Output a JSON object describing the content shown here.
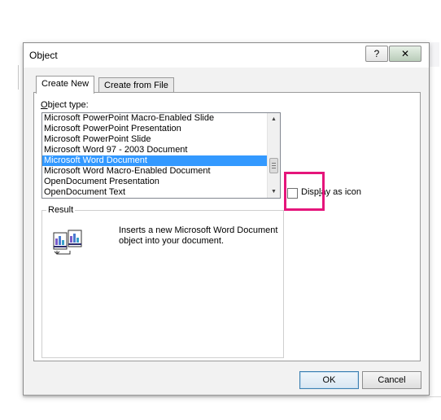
{
  "dialog": {
    "title": "Object",
    "help_glyph": "?",
    "close_glyph": "✕"
  },
  "tabs": [
    {
      "label": "Create New",
      "selected": true
    },
    {
      "label": "Create from File",
      "selected": false
    }
  ],
  "object_type": {
    "label_accel": "O",
    "label_rest": "bject type:",
    "items": [
      "Microsoft PowerPoint Macro-Enabled Slide",
      "Microsoft PowerPoint Presentation",
      "Microsoft PowerPoint Slide",
      "Microsoft Word 97 - 2003 Document",
      "Microsoft Word Document",
      "Microsoft Word Macro-Enabled Document",
      "OpenDocument Presentation",
      "OpenDocument Text"
    ],
    "selected_index": 4
  },
  "display_as_icon": {
    "label_pre": "Disp",
    "label_accel": "l",
    "label_post": "ay as icon",
    "checked": false
  },
  "result": {
    "label": "Result",
    "text": "Inserts a new Microsoft Word Document object into your document.",
    "icon": "word-document-object-icon"
  },
  "buttons": {
    "ok": "OK",
    "cancel": "Cancel"
  },
  "colors": {
    "selection": "#3399ff",
    "highlight_box": "#e5157b"
  }
}
